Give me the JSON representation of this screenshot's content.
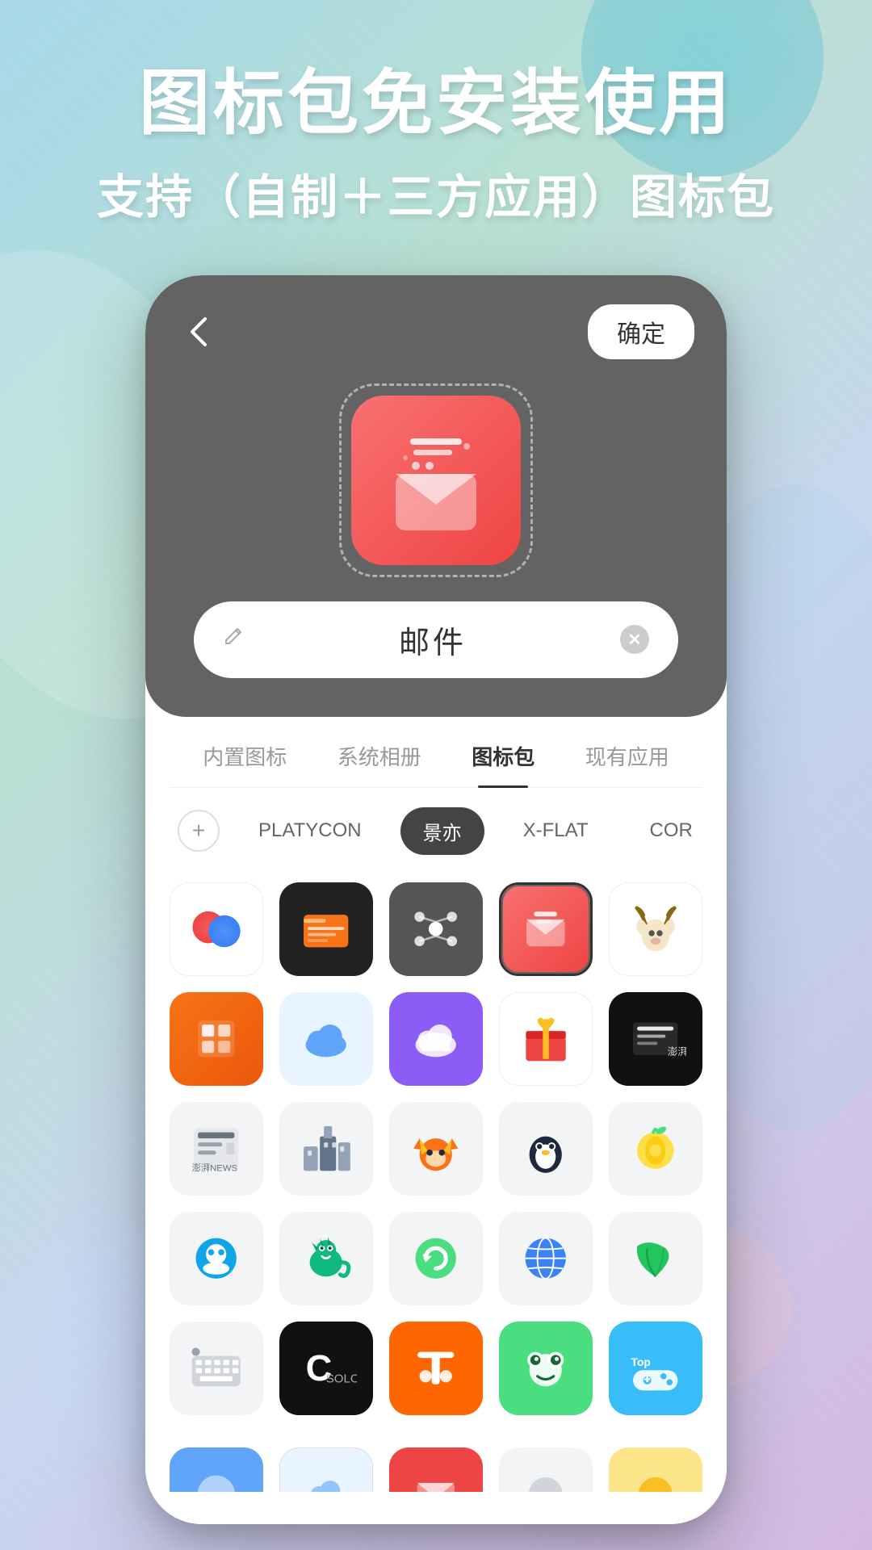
{
  "background": {
    "gradient_start": "#a8d8ea",
    "gradient_end": "#d4b8e0"
  },
  "header": {
    "title_main": "图标包免安装使用",
    "title_sub": "支持（自制＋三方应用）图标包"
  },
  "phone": {
    "nav": {
      "back_label": "‹",
      "confirm_label": "确定"
    },
    "name_field": {
      "value": "邮件",
      "placeholder": "邮件"
    },
    "tabs": [
      {
        "id": "builtin",
        "label": "内置图标"
      },
      {
        "id": "album",
        "label": "系统相册"
      },
      {
        "id": "iconpack",
        "label": "图标包",
        "active": true
      },
      {
        "id": "apps",
        "label": "现有应用"
      }
    ],
    "filter_tags": [
      {
        "id": "add",
        "type": "add"
      },
      {
        "id": "platycon",
        "label": "PLATYCON"
      },
      {
        "id": "jingyi",
        "label": "景亦",
        "active": true
      },
      {
        "id": "xflat",
        "label": "X-FLAT"
      },
      {
        "id": "cor",
        "label": "COR"
      }
    ],
    "icon_grid": {
      "rows": [
        [
          {
            "id": "pingpong",
            "bg": "#ffffff",
            "type": "pingpong"
          },
          {
            "id": "myfile",
            "bg": "#222222",
            "type": "myfile"
          },
          {
            "id": "molecule",
            "bg": "#555555",
            "type": "molecule"
          },
          {
            "id": "mail-selected",
            "bg": "#ef4444",
            "type": "mail",
            "selected": true
          },
          {
            "id": "animal",
            "bg": "#ffffff",
            "type": "animal"
          }
        ],
        [
          {
            "id": "office",
            "bg": "#f97316",
            "type": "office"
          },
          {
            "id": "cloud-blue",
            "bg": "#e8f4ff",
            "type": "cloud-blue"
          },
          {
            "id": "cloud-purple",
            "bg": "#8b5cf6",
            "type": "cloud-purple"
          },
          {
            "id": "gift",
            "bg": "#ffffff",
            "type": "gift"
          },
          {
            "id": "pengpai-black",
            "bg": "#111111",
            "type": "pengpai-black"
          }
        ],
        [
          {
            "id": "news",
            "bg": "#f3f4f6",
            "type": "news"
          },
          {
            "id": "building",
            "bg": "#f3f4f6",
            "type": "building"
          },
          {
            "id": "fox",
            "bg": "#f3f4f6",
            "type": "fox"
          },
          {
            "id": "penguin",
            "bg": "#f3f4f6",
            "type": "penguin"
          },
          {
            "id": "lemon",
            "bg": "#f3f4f6",
            "type": "lemon"
          }
        ],
        [
          {
            "id": "qq-circle",
            "bg": "#f3f4f6",
            "type": "qq-circle"
          },
          {
            "id": "dino",
            "bg": "#f3f4f6",
            "type": "dino"
          },
          {
            "id": "refresh-green",
            "bg": "#f3f4f6",
            "type": "refresh-green"
          },
          {
            "id": "globe-blue",
            "bg": "#f3f4f6",
            "type": "globe-blue"
          },
          {
            "id": "leaf-green",
            "bg": "#f3f4f6",
            "type": "leaf-green"
          }
        ],
        [
          {
            "id": "keyboard",
            "bg": "#f3f4f6",
            "type": "keyboard"
          },
          {
            "id": "soloop",
            "bg": "#111111",
            "type": "soloop"
          },
          {
            "id": "taobao",
            "bg": "#ff6600",
            "type": "taobao"
          },
          {
            "id": "frog-green",
            "bg": "#4ade80",
            "type": "frog-green"
          },
          {
            "id": "topgame",
            "bg": "#38bdf8",
            "type": "topgame"
          }
        ]
      ],
      "partial_row": [
        {
          "id": "partial-1",
          "bg": "#60a5fa",
          "type": "partial-blue"
        },
        {
          "id": "partial-2",
          "bg": "#e8f4ff",
          "type": "partial-light"
        },
        {
          "id": "partial-3",
          "bg": "#ef4444",
          "type": "partial-red"
        },
        {
          "id": "partial-4",
          "bg": "#f3f4f6",
          "type": "partial-gray"
        },
        {
          "id": "partial-5",
          "bg": "#fbbf24",
          "type": "partial-yellow"
        }
      ]
    }
  }
}
